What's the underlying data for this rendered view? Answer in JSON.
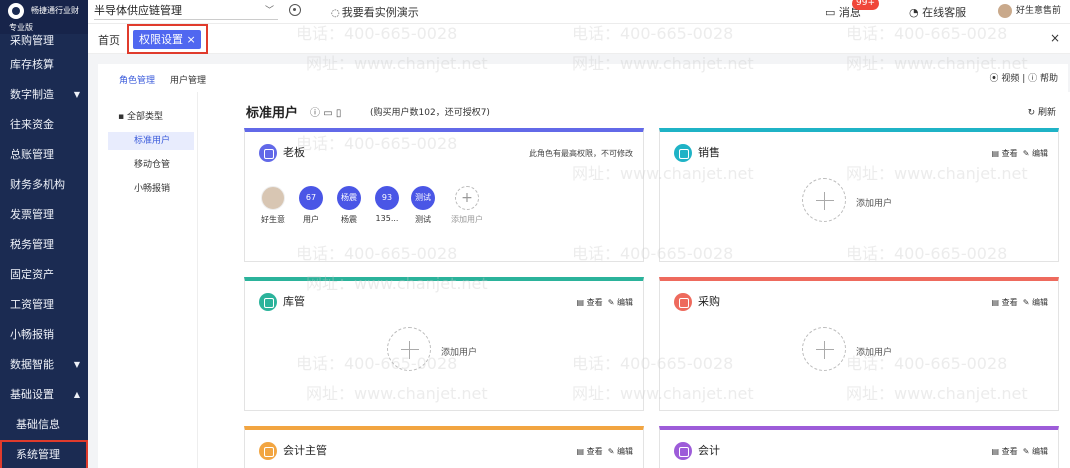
{
  "brand": {
    "name": "畅捷通行业财",
    "edition": "专业版"
  },
  "sidebar": {
    "items": [
      {
        "label": "采购管理",
        "arrow": ""
      },
      {
        "label": "库存核算",
        "arrow": ""
      },
      {
        "label": "数字制造",
        "arrow": "▼"
      },
      {
        "label": "往来资金",
        "arrow": ""
      },
      {
        "label": "总账管理",
        "arrow": ""
      },
      {
        "label": "财务多机构",
        "arrow": ""
      },
      {
        "label": "发票管理",
        "arrow": ""
      },
      {
        "label": "税务管理",
        "arrow": ""
      },
      {
        "label": "固定资产",
        "arrow": ""
      },
      {
        "label": "工资管理",
        "arrow": ""
      },
      {
        "label": "小畅报销",
        "arrow": ""
      },
      {
        "label": "数据智能",
        "arrow": "▼"
      },
      {
        "label": "基础设置",
        "arrow": "▲"
      },
      {
        "label": "基础信息",
        "arrow": ""
      },
      {
        "label": "系统管理",
        "arrow": ""
      }
    ]
  },
  "topbar": {
    "org": "半导体供应链管理",
    "demo": "我要看实例演示",
    "messages": "消息",
    "messages_badge": "99+",
    "service": "在线客服",
    "user": "好生意售前"
  },
  "tabs": {
    "home": "首页",
    "active": "权限设置 ×",
    "close": "×"
  },
  "subtabs": {
    "role": "角色管理",
    "user": "用户管理",
    "help": "⦿ 视频 | ⓘ 帮助"
  },
  "roles_list": {
    "all": "全部类型",
    "items": [
      "标准用户",
      "移动仓管",
      "小畅报销"
    ]
  },
  "main": {
    "title": "标准用户",
    "info": "(购买用户数102，还可授权7)",
    "refresh": "刷新"
  },
  "cards": {
    "boss": {
      "title": "老板",
      "note": "此角色有最高权限，不可修改",
      "color": "#6269e8"
    },
    "sales": {
      "title": "销售",
      "color": "#1fb3c6"
    },
    "warehouse": {
      "title": "库管",
      "color": "#2bb39b"
    },
    "purchase": {
      "title": "采购",
      "color": "#ee6a5d"
    },
    "acct_lead": {
      "title": "会计主管",
      "color": "#f2a541"
    },
    "acct": {
      "title": "会计",
      "color": "#9d5cd9"
    },
    "view": "查看",
    "edit": "编辑",
    "add_user": "添加用户"
  },
  "members": [
    {
      "avatar": "",
      "name": "好生意"
    },
    {
      "avatar": "67",
      "name": "用户"
    },
    {
      "avatar": "杨震",
      "name": "杨震"
    },
    {
      "avatar": "93",
      "name": "135..."
    },
    {
      "avatar": "测试",
      "name": "测试"
    },
    {
      "avatar": "+",
      "name": "添加用户"
    }
  ],
  "watermark": {
    "phone": "电话：400-665-0028",
    "site": "网址：www.chanjet.net"
  }
}
